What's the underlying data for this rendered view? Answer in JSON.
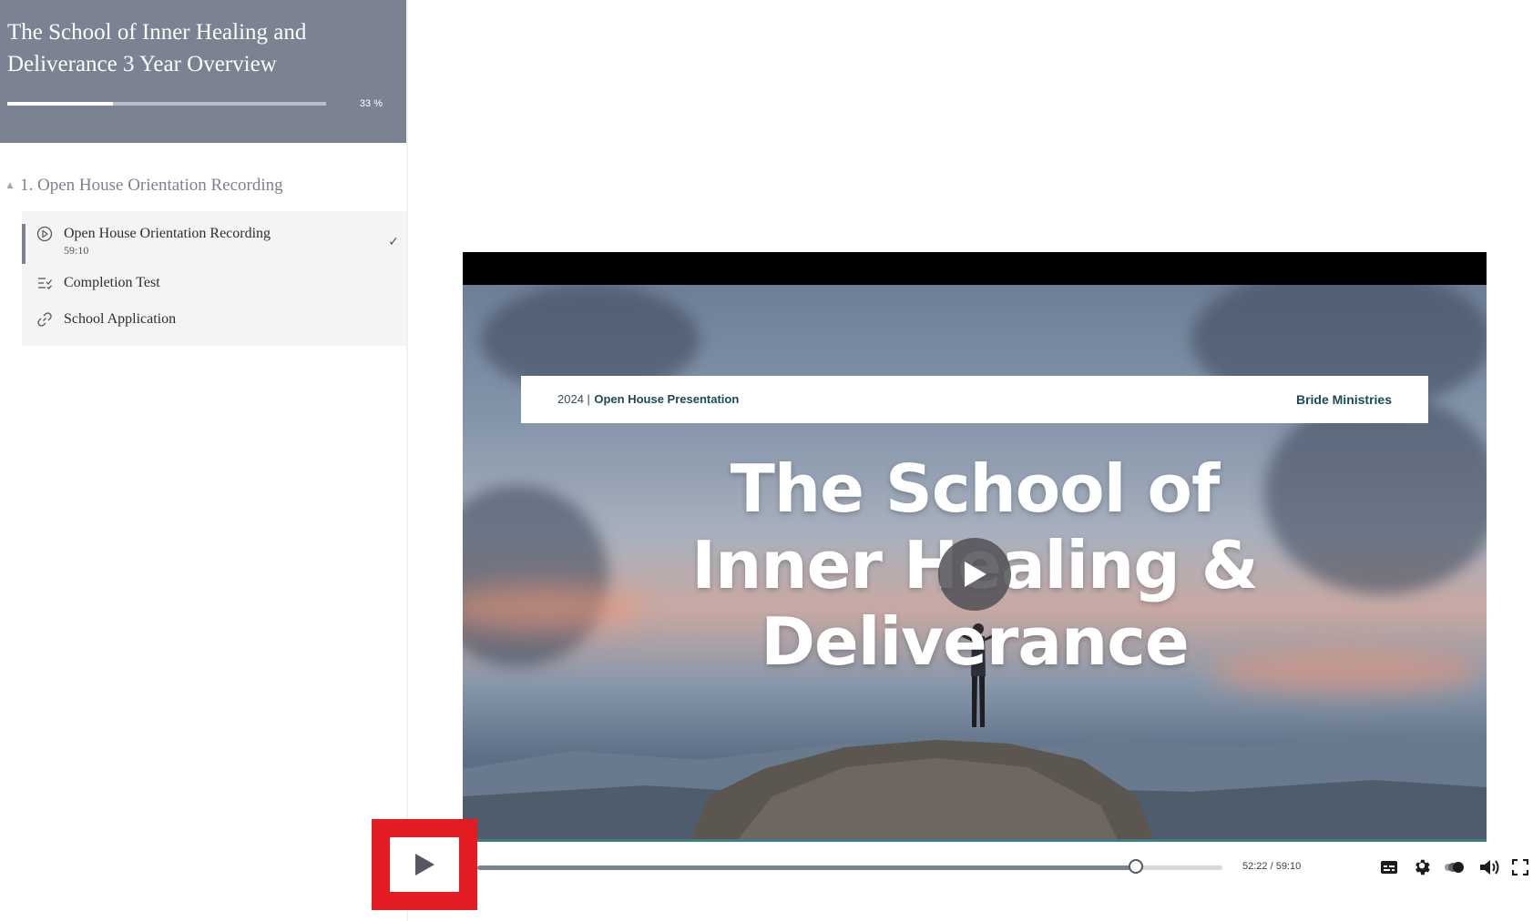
{
  "course": {
    "title": "The School of Inner Healing and Deliverance 3 Year Overview",
    "progress_label": "33 %",
    "progress_value": 0.33
  },
  "section": {
    "label": "1. Open House Orientation Recording"
  },
  "lessons": [
    {
      "title": "Open House Orientation Recording",
      "meta": "59:10",
      "icon": "play-circle-icon",
      "completed": true,
      "active": true
    },
    {
      "title": "Completion Test",
      "icon": "checklist-icon",
      "completed": false,
      "active": false
    },
    {
      "title": "School Application",
      "icon": "link-icon",
      "completed": false,
      "active": false
    }
  ],
  "video": {
    "banner_year": "2024 |",
    "banner_presentation": "Open House Presentation",
    "banner_brand": "Bride Ministries",
    "slide_title_line1": "The School of",
    "slide_title_line2": "Inner Healing &",
    "slide_title_line3": "Deliverance"
  },
  "player": {
    "time": "52:22 / 59:10",
    "playback_fraction": 0.885,
    "accent_color": "#e31b23"
  },
  "colors": {
    "header_bg": "#7b8291",
    "active_bar": "#7b8291"
  }
}
